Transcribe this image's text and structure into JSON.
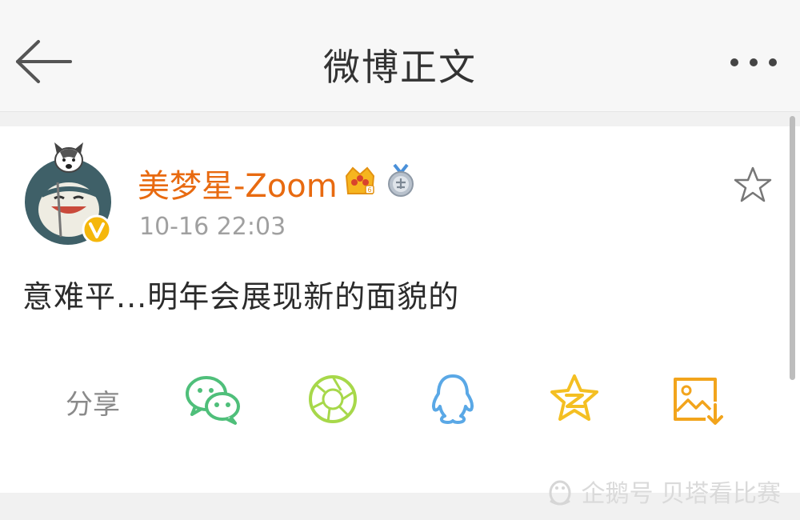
{
  "header": {
    "title": "微博正文"
  },
  "post": {
    "author": "美梦星-Zoom",
    "timestamp": "10-16 22:03",
    "content": "意难平...明年会展现新的面貌的"
  },
  "share": {
    "label": "分享"
  },
  "watermark": {
    "text": "企鹅号 贝塔看比赛"
  },
  "colors": {
    "username": "#e86a10",
    "wechat": "#4fbf7a",
    "moments": "#a7d84a",
    "qq": "#5aa8e6",
    "qzone": "#f4bf22",
    "save": "#f2a41c"
  },
  "icons": [
    "back-arrow-icon",
    "more-dots-icon",
    "avatar",
    "verified-v-icon",
    "crown-badge-icon",
    "medal-badge-icon",
    "star-favorite-icon",
    "wechat-icon",
    "moments-icon",
    "qq-icon",
    "qzone-icon",
    "save-image-icon",
    "penguin-logo-icon"
  ]
}
